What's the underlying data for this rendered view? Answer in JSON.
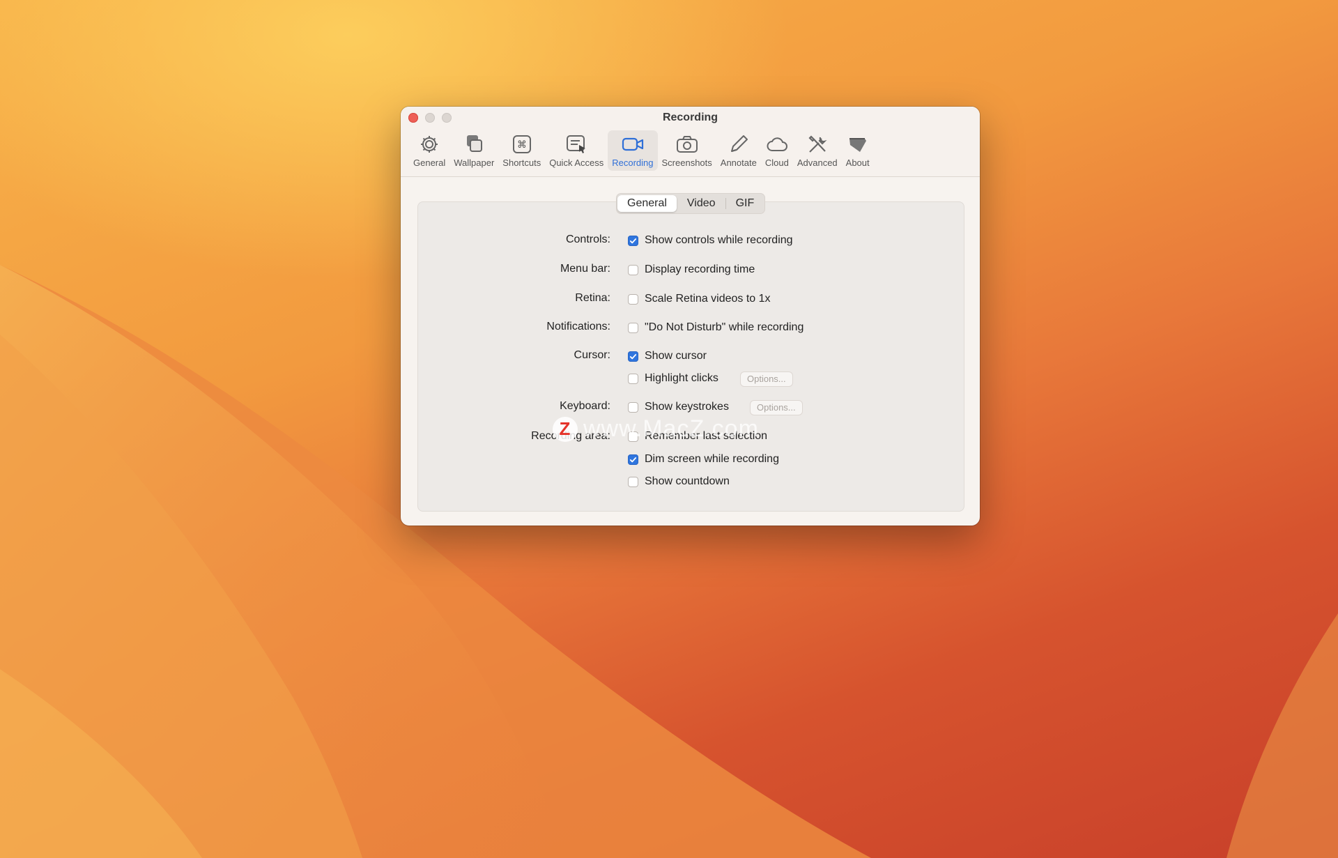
{
  "window": {
    "title": "Recording"
  },
  "toolbar": {
    "items": [
      {
        "label": "General",
        "icon": "gear-icon"
      },
      {
        "label": "Wallpaper",
        "icon": "wallpaper-icon"
      },
      {
        "label": "Shortcuts",
        "icon": "command-key-icon"
      },
      {
        "label": "Quick Access",
        "icon": "quick-access-icon"
      },
      {
        "label": "Recording",
        "icon": "video-camera-icon",
        "active": true
      },
      {
        "label": "Screenshots",
        "icon": "camera-icon"
      },
      {
        "label": "Annotate",
        "icon": "pencil-icon"
      },
      {
        "label": "Cloud",
        "icon": "cloud-icon"
      },
      {
        "label": "Advanced",
        "icon": "tools-icon"
      },
      {
        "label": "About",
        "icon": "about-icon"
      }
    ]
  },
  "tabs": {
    "general": "General",
    "video": "Video",
    "gif": "GIF",
    "selected": "General"
  },
  "settings": {
    "controls_label": "Controls:",
    "show_controls": "Show controls while recording",
    "menubar_label": "Menu bar:",
    "display_time": "Display recording time",
    "retina_label": "Retina:",
    "scale_retina": "Scale Retina videos to 1x",
    "notifications_label": "Notifications:",
    "dnd": "\"Do Not Disturb\" while recording",
    "cursor_label": "Cursor:",
    "show_cursor": "Show cursor",
    "highlight_clicks": "Highlight clicks",
    "highlight_options": "Options...",
    "keyboard_label": "Keyboard:",
    "show_keystrokes": "Show keystrokes",
    "keystrokes_options": "Options...",
    "area_label": "Recording area:",
    "remember_selection": "Remember last selection",
    "dim_screen": "Dim screen while recording",
    "show_countdown": "Show countdown"
  },
  "checked": {
    "show_controls": true,
    "display_time": false,
    "scale_retina": false,
    "dnd": false,
    "show_cursor": true,
    "highlight_clicks": false,
    "show_keystrokes": false,
    "remember_selection": false,
    "dim_screen": true,
    "show_countdown": false
  },
  "colors": {
    "accent": "#2f75de",
    "close_button": "#ee5f57"
  },
  "watermark": {
    "logo": "Z",
    "text": "www.MacZ.com"
  }
}
